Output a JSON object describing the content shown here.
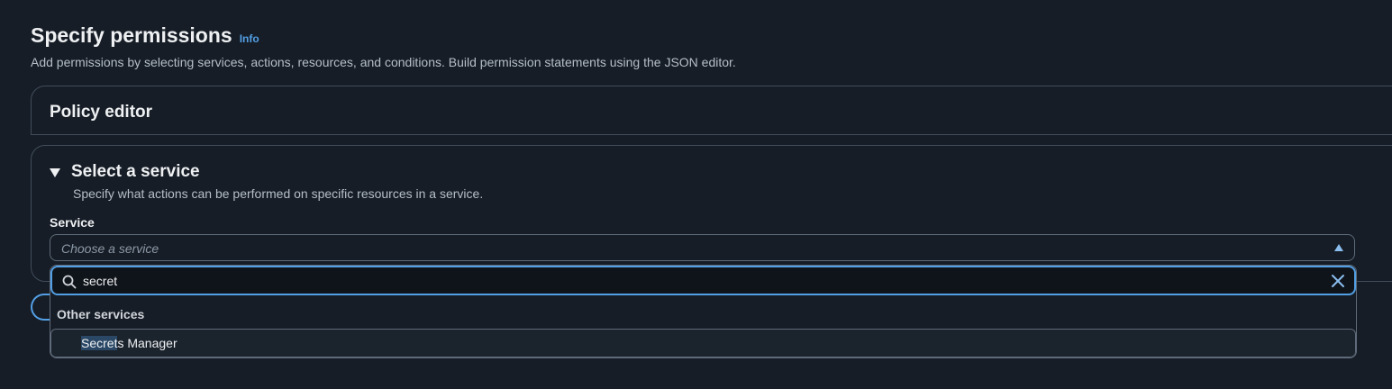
{
  "header": {
    "title": "Specify permissions",
    "info": "Info",
    "description": "Add permissions by selecting services, actions, resources, and conditions. Build permission statements using the JSON editor."
  },
  "policy_editor": {
    "title": "Policy editor"
  },
  "service_section": {
    "title": "Select a service",
    "description": "Specify what actions can be performed on specific resources in a service.",
    "field_label": "Service",
    "placeholder": "Choose a service"
  },
  "dropdown": {
    "search_value": "secret",
    "group_label": "Other services",
    "options": [
      {
        "match": "Secret",
        "rest": "s Manager"
      }
    ]
  },
  "colors": {
    "accent": "#539fe5",
    "background": "#161d26",
    "border": "#5f6b7a"
  },
  "icons": [
    "caret-down-icon",
    "caret-up-icon",
    "search-icon",
    "clear-icon"
  ]
}
